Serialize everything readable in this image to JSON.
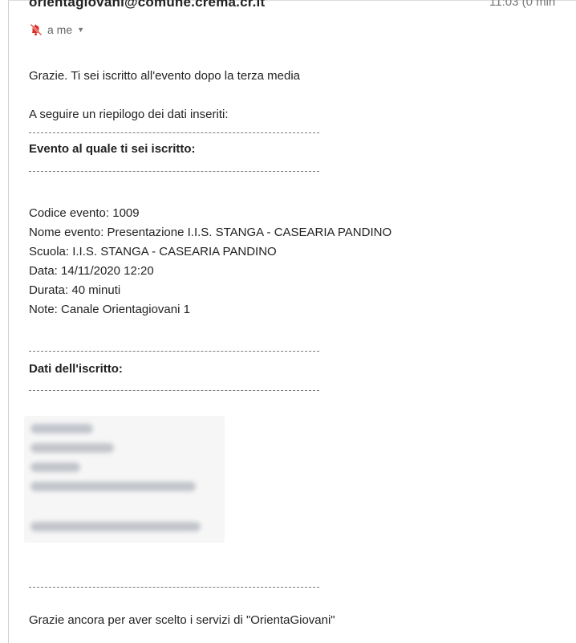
{
  "email": {
    "sender": "orientagiovani@comune.crema.cr.it",
    "time": "11:03 (0 min",
    "recipient": "a me",
    "icons": {
      "unsubscribe": "mute-bell-icon",
      "recipient_menu": "chevron-down-icon"
    },
    "accent_color": "#d93025"
  },
  "body": {
    "greeting": "Grazie. Ti sei iscritto all'evento dopo la terza media",
    "summary_intro": "A seguire un riepilogo dei dati inseriti:",
    "separator": "--------------------------------------------------------------------",
    "event_heading": "Evento al quale ti sei iscritto:",
    "event_lines": [
      "Codice evento: 1009",
      "Nome evento: Presentazione I.I.S. STANGA - CASEARIA PANDINO",
      "Scuola: I.I.S. STANGA - CASEARIA PANDINO",
      "Data: 14/11/2020 12:20",
      "Durata: 40 minuti",
      "Note: Canale Orientagiovani 1"
    ],
    "registrant_heading": "Dati dell'iscritto:",
    "closing": "Grazie ancora per aver scelto i servizi di \"OrientaGiovani\""
  }
}
